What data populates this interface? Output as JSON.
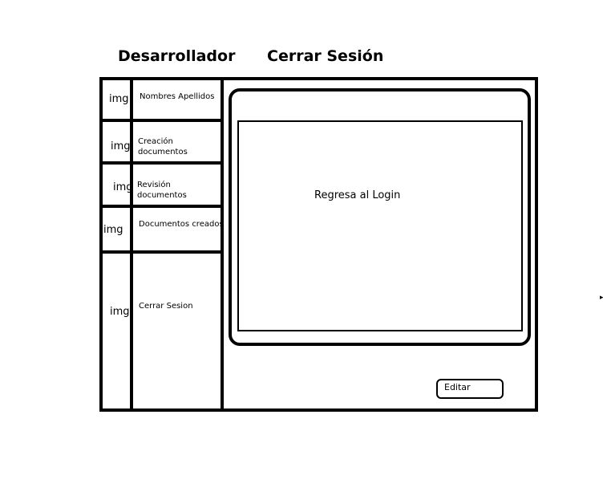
{
  "header": {
    "role_label": "Desarrollador",
    "logout_label": "Cerrar Sesión"
  },
  "sidebar": {
    "items": [
      {
        "icon_text": "img",
        "label": "Nombres Apellidos"
      },
      {
        "icon_text": "img",
        "label": "Creación documentos"
      },
      {
        "icon_text": "img",
        "label": "Revisión documentos"
      },
      {
        "icon_text": "img",
        "label": "Documentos creados"
      },
      {
        "icon_text": "img",
        "label": "Cerrar Sesion"
      }
    ]
  },
  "main": {
    "screen_text": "Regresa al Login",
    "edit_label": "Editar"
  }
}
